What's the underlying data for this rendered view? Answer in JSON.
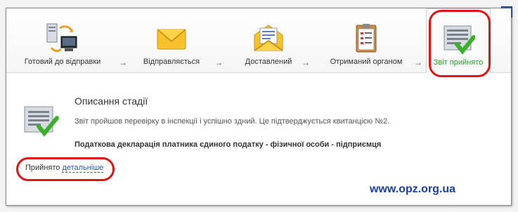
{
  "window": {
    "close_label": "×"
  },
  "steps": [
    {
      "label": "Готовий до відправки",
      "icon": "computer-sync-icon"
    },
    {
      "label": "Відправляється",
      "icon": "envelope-icon"
    },
    {
      "label": "Доставлений",
      "icon": "open-envelope-icon"
    },
    {
      "label": "Отриманий органом",
      "icon": "clipboard-icon"
    },
    {
      "label": "Звіт прийнято",
      "icon": "report-accepted-icon",
      "active": true
    }
  ],
  "arrow": "→",
  "stage": {
    "title": "Описання стадії",
    "description": "Звіт пройшов перевірку в інспекції і успішно здний. Це підтверджується квитанцією №2.",
    "declaration": "Податкова декларація платника єдиного податку - фізичної особи - підприємця",
    "accepted_prefix": "Прийнято",
    "details_link": "детальніше"
  },
  "watermark": "www.opz.org.ua",
  "colors": {
    "accent_green": "#2e9b2e",
    "highlight_red": "#e01414",
    "link_blue": "#2a55a8"
  }
}
